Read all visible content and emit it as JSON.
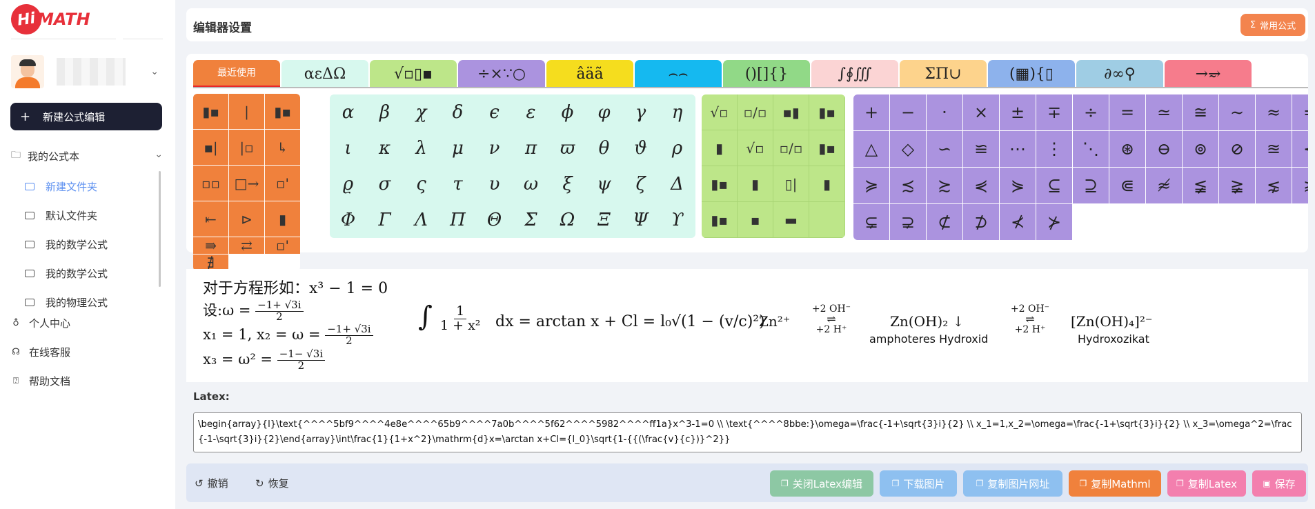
{
  "brand": {
    "hi": "Hi",
    "math": "MATH"
  },
  "sidebar": {
    "new_formula": "新建公式编辑",
    "book_title": "我的公式本",
    "folders": [
      "新建文件夹",
      "默认文件夹",
      "我的数学公式",
      "我的数学公式",
      "我的物理公式"
    ],
    "nav": [
      "个人中心",
      "在线客服",
      "帮助文档"
    ]
  },
  "header": {
    "title": "编辑器设置",
    "common_formula": "常用公式"
  },
  "tabs": [
    {
      "label": "最近使用",
      "color": "#f0813c"
    },
    {
      "label": "αεΔΩ",
      "color": "#d7f8ee"
    },
    {
      "label": "√▫▯▪",
      "color": "#bde689"
    },
    {
      "label": "÷×∵○",
      "color": "#ab93df"
    },
    {
      "label": "âäã",
      "color": "#f5dd1e"
    },
    {
      "label": "⌢⌢",
      "color": "#15b9f0"
    },
    {
      "label": "()[]{}",
      "color": "#91d987"
    },
    {
      "label": "∫∮∭",
      "color": "#fbd4d4"
    },
    {
      "label": "ΣΠ∪",
      "color": "#fdd38c"
    },
    {
      "label": "(▦){▯",
      "color": "#8db2ec"
    },
    {
      "label": "∂∞⚲",
      "color": "#9fcde4"
    },
    {
      "label": "→⥴",
      "color": "#f67c8c"
    }
  ],
  "panel_recent": [
    "▮▪",
    "|",
    "▮▪",
    "▪|",
    "|▫",
    "↳",
    "▫▫",
    "□→",
    "▫'",
    "⇤",
    "⊳",
    "▮",
    "⇛",
    "⇄",
    "▫'",
    "∄"
  ],
  "panel_greek": [
    "α",
    "β",
    "χ",
    "δ",
    "ϵ",
    "ε",
    "ϕ",
    "φ",
    "γ",
    "η",
    "ι",
    "κ",
    "λ",
    "μ",
    "ν",
    "π",
    "ϖ",
    "θ",
    "ϑ",
    "ρ",
    "ϱ",
    "σ",
    "ς",
    "τ",
    "υ",
    "ω",
    "ξ",
    "ψ",
    "ζ",
    "Δ",
    "Φ",
    "Γ",
    "Λ",
    "Π",
    "Θ",
    "Σ",
    "Ω",
    "Ξ",
    "Ψ",
    "ϒ"
  ],
  "panel_radical": [
    "√▫",
    "▫/▫",
    "▪▮",
    "▮▪",
    "▮",
    "√▫",
    "▫/▫",
    "▮▪",
    "▮▪",
    "▮",
    "▯|",
    "▮",
    "▮▪",
    "▪",
    "▬",
    ""
  ],
  "panel_operators": [
    "+",
    "−",
    "·",
    "×",
    "±",
    "∓",
    "÷",
    "=",
    "≃",
    "≅",
    "∼",
    "≈",
    "≐",
    "□",
    "○",
    "△",
    "◇",
    "∽",
    "≌",
    "⋯",
    "⋮",
    "⋱",
    "⊛",
    "⊖",
    "⊚",
    "⊘",
    "≊",
    "≺",
    "≻",
    "≼",
    "≽",
    "≾",
    "≿",
    "⋞",
    "⋟",
    "⊆",
    "⊇",
    "⋐",
    "≉",
    "≨",
    "≩",
    "⋦",
    "⋧",
    "⊈",
    "⊉",
    "⊊",
    "⊋",
    "⊄",
    "⊅",
    "⊀",
    "⊁"
  ],
  "preview": {
    "line1": "对于方程形如：x³ − 1 = 0",
    "line2_prefix": "设:ω =",
    "frac_num": "−1+ √3i",
    "frac_den": "2",
    "line3_prefix": "x₁ = 1, x₂ = ω =",
    "line4_prefix": "x₃ = ω² =",
    "frac4_num": "−1− √3i",
    "integral": "∫",
    "int_num": "1",
    "int_den": "1 + x²",
    "int_rest": "dx = arctan x + Cl = l₀√(1 − (v/c)²)",
    "zn": "Zn²⁺",
    "arrow1_top": "+2 OH⁻",
    "arrow1_bottom": "+2 H⁺",
    "znoh2": "Zn(OH)₂ ↓",
    "amphoteres": "amphoteres Hydroxid",
    "arrow2_top": "+2 OH⁻",
    "arrow2_bottom": "+2 H⁺",
    "znoh4": "[Zn(OH)₄]²⁻",
    "hydroxozikat": "Hydroxozikat"
  },
  "latex": {
    "label": "Latex:",
    "value": "\\begin{array}{l}\\text{^^^^5bf9^^^^4e8e^^^^65b9^^^^7a0b^^^^5f62^^^^5982^^^^ff1a}x^3-1=0 \\\\ \\text{^^^^8bbe:}\\omega=\\frac{-1+\\sqrt{3}i}{2} \\\\ x_1=1,x_2=\\omega=\\frac{-1+\\sqrt{3}i}{2} \\\\ x_3=\\omega^2=\\frac{-1-\\sqrt{3}i}{2}\\end{array}\\int\\frac{1}{1+x^2}\\mathrm{d}x=\\arctan x+Cl={l_0}\\sqrt{1-{{(\\frac{v}{c})}^2}}"
  },
  "footer": {
    "undo": "撤销",
    "redo": "恢复",
    "close_latex": "关闭Latex编辑",
    "download": "下载图片",
    "copy_url": "复制图片网址",
    "copy_mathml": "复制Mathml",
    "copy_latex": "复制Latex",
    "save": "保存"
  }
}
